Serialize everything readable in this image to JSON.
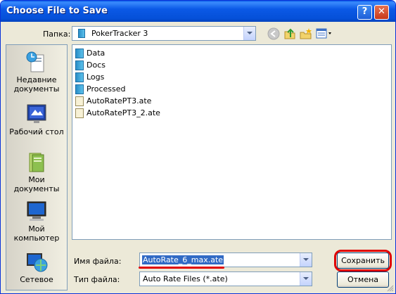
{
  "window": {
    "title": "Choose File to Save"
  },
  "location": {
    "label": "Папка:",
    "current_folder": "PokerTracker 3"
  },
  "places": [
    {
      "label": "Недавние документы",
      "icon": "recent-documents-icon"
    },
    {
      "label": "Рабочий стол",
      "icon": "desktop-icon"
    },
    {
      "label": "Мои документы",
      "icon": "my-documents-icon"
    },
    {
      "label": "Мой компьютер",
      "icon": "my-computer-icon"
    },
    {
      "label": "Сетевое",
      "icon": "network-icon"
    }
  ],
  "files": [
    {
      "name": "Data",
      "type": "folder"
    },
    {
      "name": "Docs",
      "type": "folder"
    },
    {
      "name": "Logs",
      "type": "folder"
    },
    {
      "name": "Processed",
      "type": "folder"
    },
    {
      "name": "AutoRatePT3.ate",
      "type": "file"
    },
    {
      "name": "AutoRatePT3_2.ate",
      "type": "file"
    }
  ],
  "filename": {
    "label": "Имя файла:",
    "value": "AutoRate_6_max.ate"
  },
  "filetype": {
    "label": "Тип файла:",
    "value": "Auto Rate Files (*.ate)"
  },
  "buttons": {
    "save": "Сохранить",
    "cancel": "Отмена",
    "help": "?",
    "close": "✕"
  },
  "colors": {
    "title_bar": "#0b59e6",
    "annotation_red": "#e00000",
    "selection": "#316ac5"
  }
}
